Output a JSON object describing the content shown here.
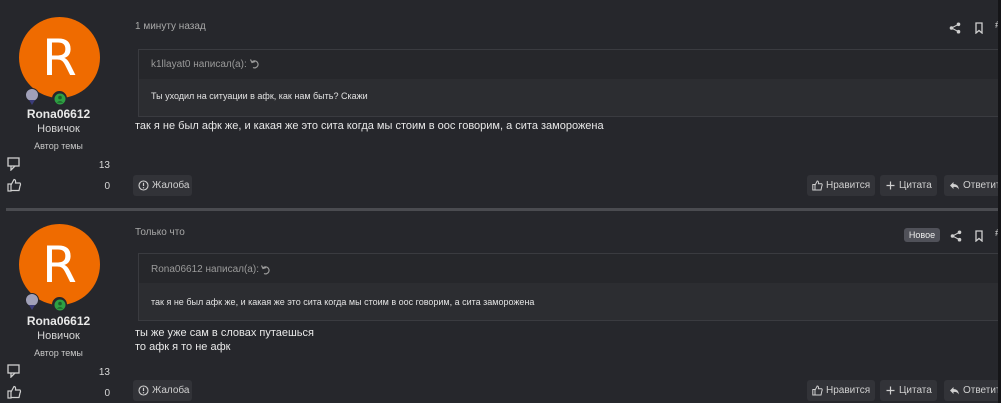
{
  "posts": [
    {
      "avatar_letter": "R",
      "username": "Rona06612",
      "rank": "Новичок",
      "role": "Автор темы",
      "messages_count": "13",
      "likes_count": "0",
      "time": "1 минуту назад",
      "is_new": false,
      "quote": {
        "author": "k1llayat0 написал(а):",
        "text": "Ты уходил на ситуации в афк, как нам быть? Скажи"
      },
      "message_lines": [
        "так я не был афк же, и какая же это сита когда мы стоим в оос говорим, а сита заморожена"
      ],
      "actions": {
        "report": "Жалоба",
        "like": "Нравится",
        "quote": "Цитата",
        "reply": "Ответить"
      }
    },
    {
      "avatar_letter": "R",
      "username": "Rona06612",
      "rank": "Новичок",
      "role": "Автор темы",
      "messages_count": "13",
      "likes_count": "0",
      "time": "Только что",
      "is_new": true,
      "new_label": "Новое",
      "quote": {
        "author": "Rona06612 написал(а):",
        "text": "так я не был афк же, и какая же это сита когда мы стоим в оос говорим, а сита заморожена"
      },
      "message_lines": [
        "ты же уже сам в словах путаешься",
        "то афк я то не афк"
      ],
      "actions": {
        "report": "Жалоба",
        "like": "Нравится",
        "quote": "Цитата",
        "reply": "Ответить"
      }
    }
  ],
  "icons": {
    "share": "share-icon",
    "bookmark": "bookmark-icon",
    "permalink": "#",
    "messages": "messages-icon",
    "likes": "thumbs-up-icon",
    "report": "alert-circle-icon",
    "quote_jump": "jump-arrow-icon"
  },
  "colors": {
    "background": "#26272c",
    "avatar": "#ef6b00",
    "online": "#2ea043"
  }
}
